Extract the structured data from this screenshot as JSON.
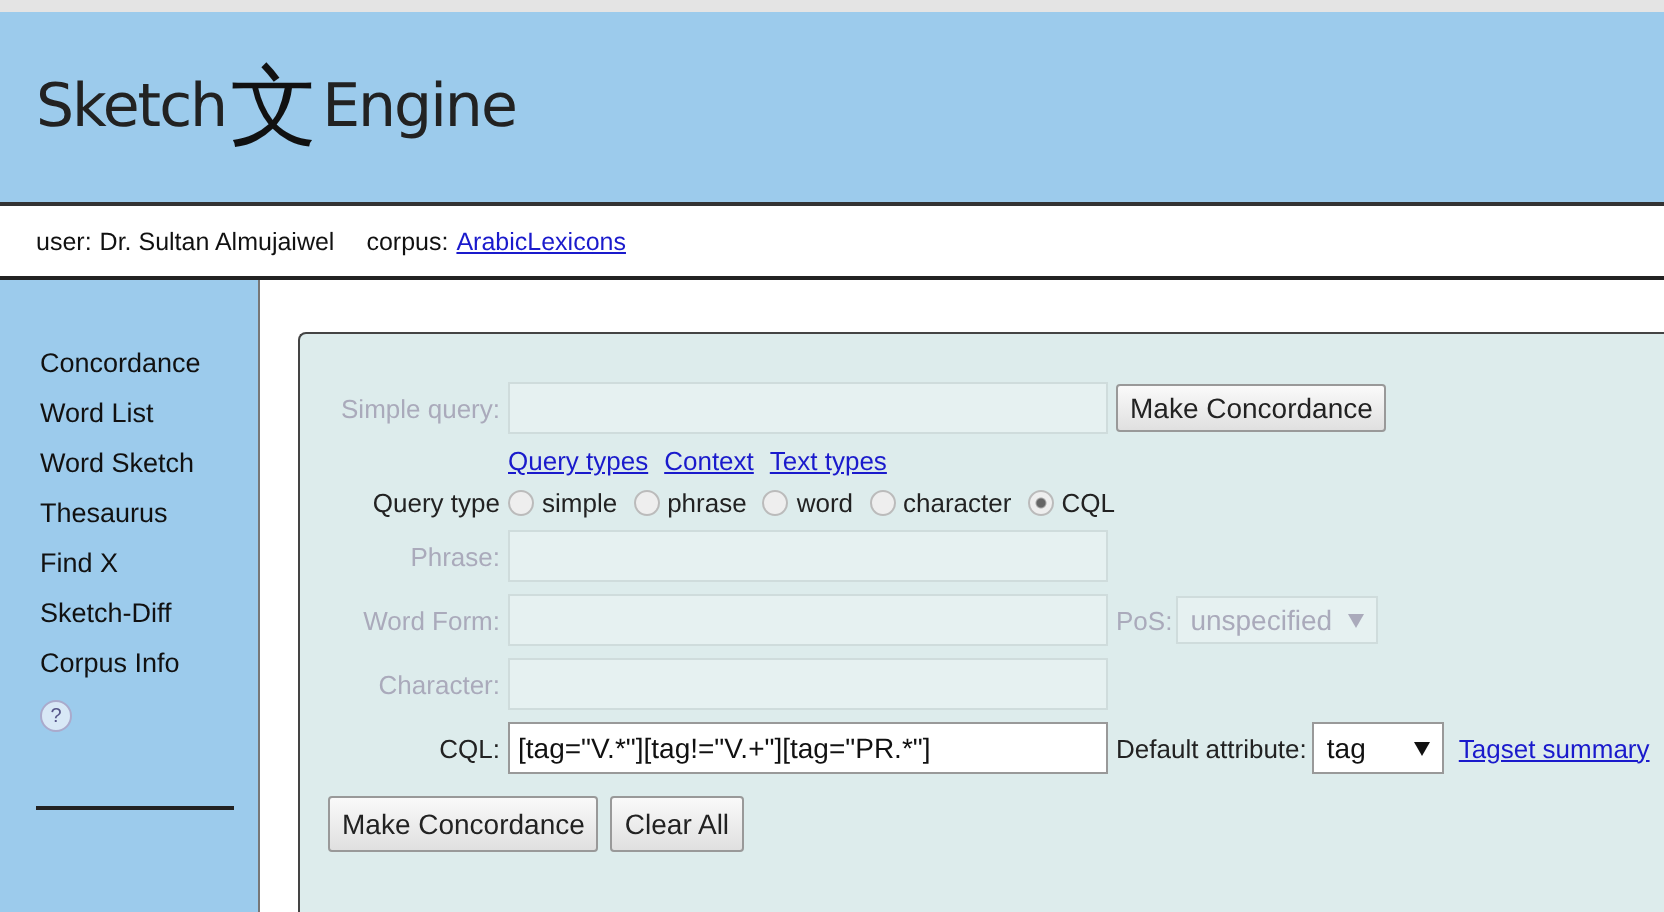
{
  "header": {
    "logo_left": "Sketch",
    "logo_mark": "文",
    "logo_right": "Engine"
  },
  "user_bar": {
    "user_label": "user:",
    "user": "Dr. Sultan Almujaiwel",
    "corpus_label": "corpus:",
    "corpus": "ArabicLexicons"
  },
  "sidebar": {
    "items": [
      "Concordance",
      "Word List",
      "Word Sketch",
      "Thesaurus",
      "Find X",
      "Sketch-Diff",
      "Corpus Info"
    ],
    "help": "?"
  },
  "form": {
    "simple_query": {
      "label": "Simple query:",
      "disabled": true,
      "button": "Make Concordance"
    },
    "links": [
      "Query types",
      "Context",
      "Text types"
    ],
    "query_type": {
      "label": "Query type",
      "options": [
        {
          "label": "simple",
          "selected": false
        },
        {
          "label": "phrase",
          "selected": false
        },
        {
          "label": "word",
          "selected": false
        },
        {
          "label": "character",
          "selected": false
        },
        {
          "label": "CQL",
          "selected": true
        }
      ]
    },
    "phrase": {
      "label": "Phrase:",
      "disabled": true
    },
    "word_form": {
      "label": "Word Form:",
      "disabled": true,
      "pos_label": "PoS:",
      "pos_value": "unspecified"
    },
    "character": {
      "label": "Character:",
      "disabled": true
    },
    "cql": {
      "label": "CQL:",
      "disabled": false,
      "value": "[tag=\"V.*\"][tag!=\"V.+\"][tag=\"PR.*\"]",
      "attr_label": "Default attribute:",
      "attr_value": "tag",
      "link": "Tagset summary"
    },
    "buttons": [
      "Make Concordance",
      "Clear All"
    ]
  }
}
